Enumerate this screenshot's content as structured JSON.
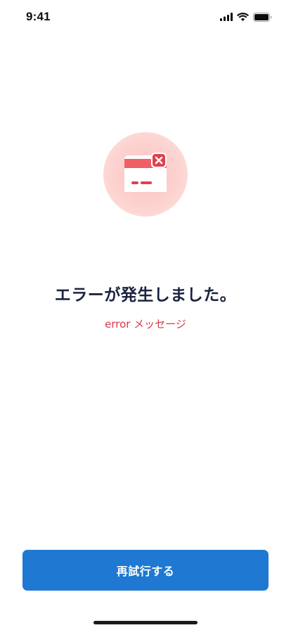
{
  "status_bar": {
    "time": "9:41",
    "signal_icon": "cellular-signal-icon",
    "wifi_icon": "wifi-icon",
    "battery_icon": "battery-icon"
  },
  "illustration": {
    "icon": "card-error-icon",
    "colors": {
      "circle": "#fcd2cf",
      "card": "#ef5f65",
      "badge": "#e0414b"
    }
  },
  "error": {
    "title": "エラーが発生しました。",
    "message": "error メッセージ"
  },
  "actions": {
    "retry_label": "再試行する"
  },
  "colors": {
    "title": "#1b2440",
    "message": "#d93848",
    "button": "#1f78d1"
  }
}
